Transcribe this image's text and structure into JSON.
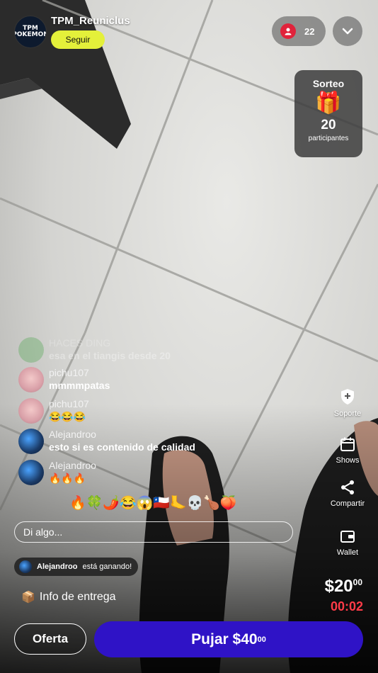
{
  "header": {
    "host_name": "TPM_Reuniclus",
    "host_avatar_text": "TPM POKEMON",
    "follow_label": "Seguir",
    "viewer_count": "22"
  },
  "raffle": {
    "title": "Sorteo",
    "gift_emoji": "🎁",
    "count": "20",
    "label": "participantes"
  },
  "chat": [
    {
      "user": "HACES DING",
      "message": "esa en el tiangis desde 20",
      "faded": true
    },
    {
      "user": "pichu107",
      "message": "mmmmpatas"
    },
    {
      "user": "pichu107",
      "message": "😂😂😂"
    },
    {
      "user": "Alejandroo",
      "message": "esto si es contenido de calidad"
    },
    {
      "user": "Alejandroo",
      "message": "🔥🔥🔥"
    }
  ],
  "emoji_bar": "🔥🍀🌶️😂😱🇨🇱🦶💀🍗🍑",
  "input": {
    "placeholder": "Di algo..."
  },
  "winner": {
    "user": "Alejandroo",
    "text": "está ganando!"
  },
  "delivery": {
    "icon": "📦",
    "label": "Info de entrega"
  },
  "rail": {
    "support": "Soporte",
    "shows": "Shows",
    "share": "Compartir",
    "wallet": "Wallet"
  },
  "auction": {
    "price_main": "$20",
    "price_cents": "00",
    "timer": "00:02",
    "offer_label": "Oferta",
    "bid_main": "Pujar $40",
    "bid_cents": "00"
  },
  "colors": {
    "follow": "#e4f03a",
    "bid_button": "#2f13c6",
    "timer": "#ff3b48",
    "live_dot": "#e0233b"
  }
}
